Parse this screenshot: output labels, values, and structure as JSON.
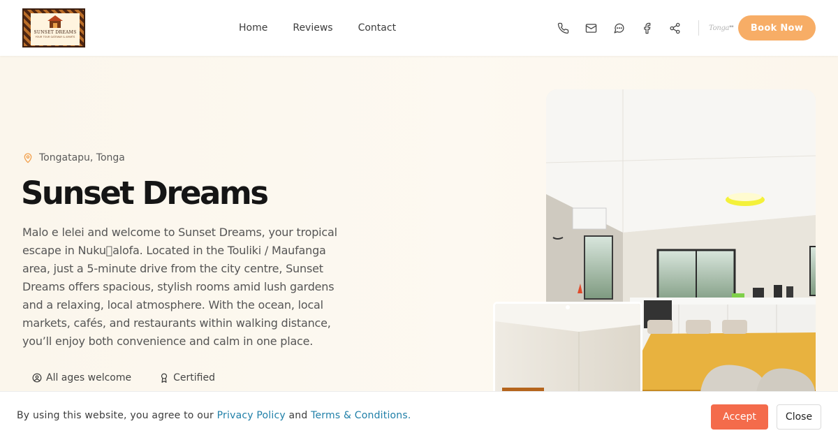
{
  "brand": {
    "logo_text": "SUNSET DREAMS",
    "logo_tagline": "YOUR TOUR GATEWAY & APARTS",
    "partner_logo": "Tonga"
  },
  "nav": {
    "items": [
      "Home",
      "Reviews",
      "Contact"
    ]
  },
  "header_icons": [
    "phone-icon",
    "mail-icon",
    "chat-icon",
    "facebook-icon",
    "share-icon"
  ],
  "book_button": "Book Now",
  "hero": {
    "location": "Tongatapu, Tonga",
    "title": "Sunset Dreams",
    "description": "Malo e lelei and welcome to Sunset Dreams, your tropical escape in Nuku\u0000alofa. Located in the Touliki / Maufanga area, just a 5-minute drive from the city centre, Sunset Dreams offers spacious, stylish rooms amid lush gardens and a relaxing, local atmosphere. With the ocean, local markets, cafés, and restaurants within walking distance, you’ll enjoy both convenience and calm in one place.",
    "features": [
      "All ages welcome",
      "Certified"
    ]
  },
  "cookie": {
    "text_before": "By using this website, you agree to our ",
    "privacy_link": "Privacy Policy",
    "text_mid": " and ",
    "terms_link": "Terms & Conditions.",
    "accept": "Accept",
    "close": "Close"
  },
  "colors": {
    "accent": "#f7ad66",
    "accept": "#f46b4b",
    "link": "#1f7fa8"
  }
}
